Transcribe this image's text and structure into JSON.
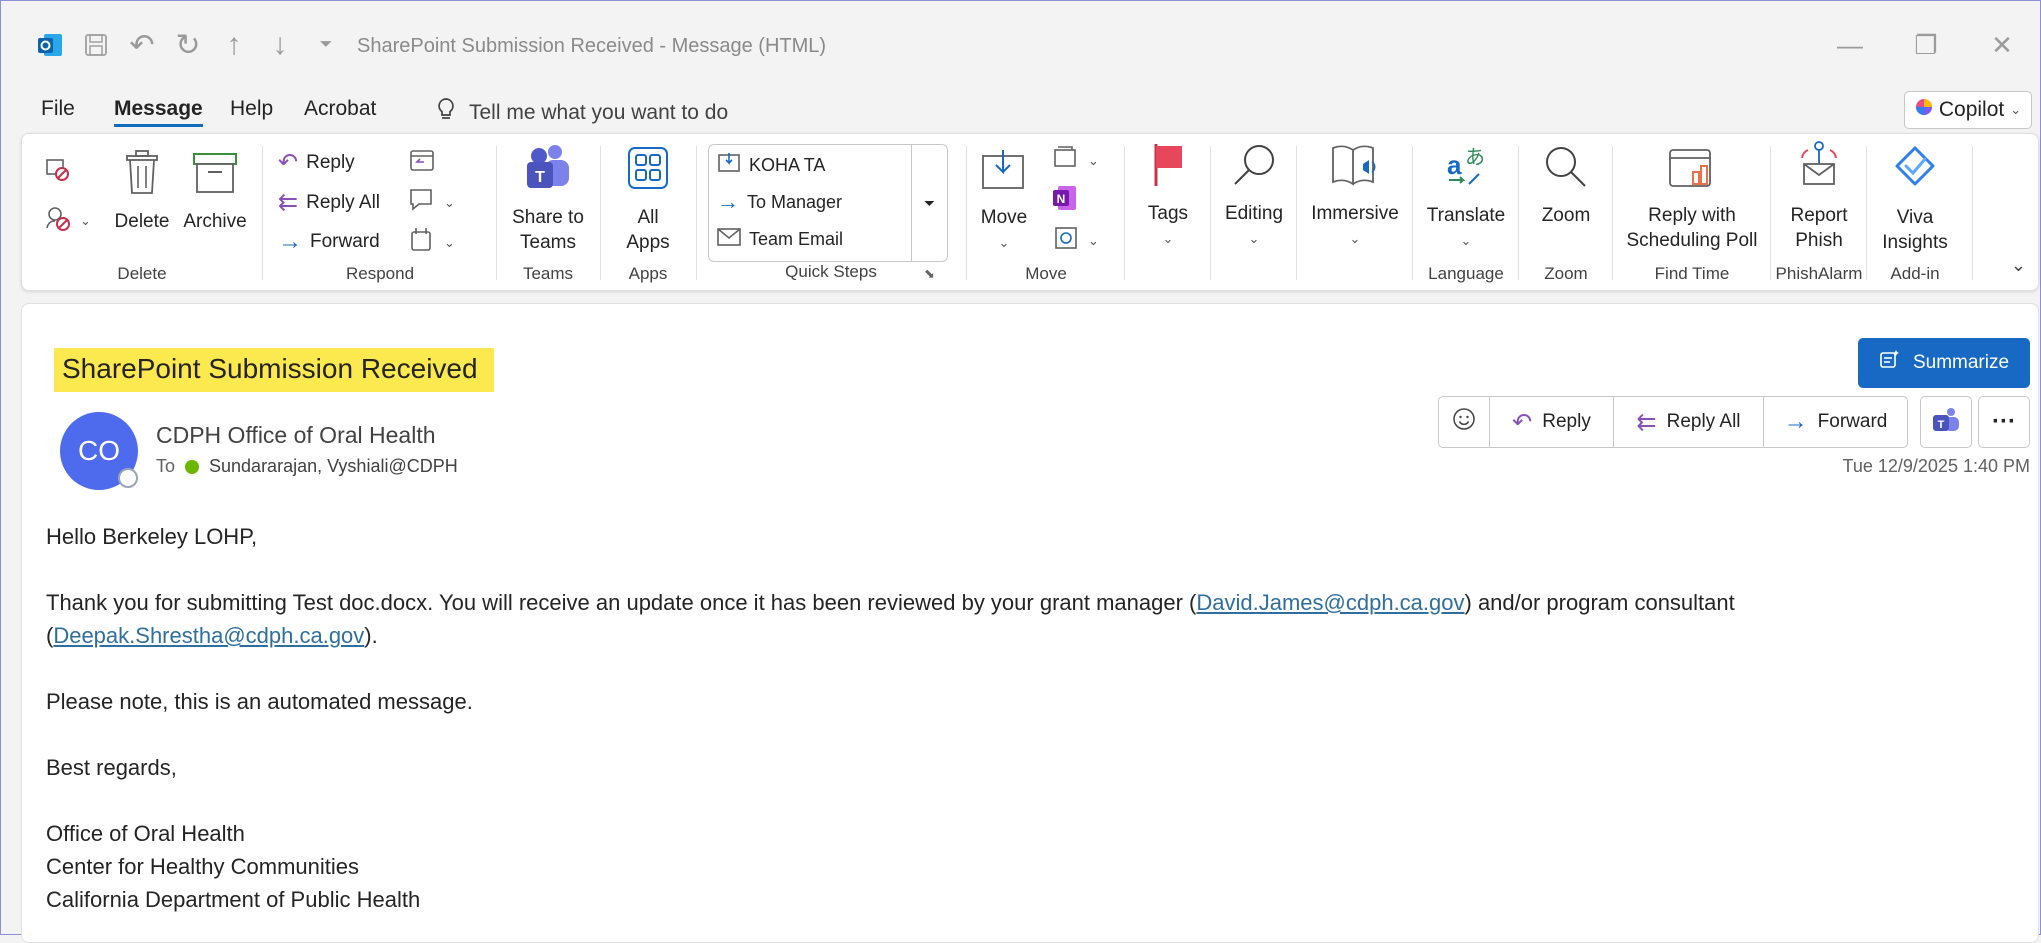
{
  "window": {
    "title": "SharePoint Submission Received  -  Message (HTML)"
  },
  "menu": {
    "file": "File",
    "message": "Message",
    "help": "Help",
    "acrobat": "Acrobat",
    "tellme": "Tell me what you want to do",
    "copilot": "Copilot"
  },
  "ribbon": {
    "delete_group": {
      "delete": "Delete",
      "archive": "Archive",
      "label": "Delete"
    },
    "respond_group": {
      "reply": "Reply",
      "reply_all": "Reply All",
      "forward": "Forward",
      "label": "Respond"
    },
    "teams_group": {
      "share": "Share to Teams",
      "label": "Teams"
    },
    "apps_group": {
      "all_apps": "All Apps",
      "label": "Apps"
    },
    "quick_steps": {
      "items": [
        "KOHA TA",
        "To Manager",
        "Team Email"
      ],
      "label": "Quick Steps"
    },
    "move_group": {
      "move": "Move",
      "label": "Move"
    },
    "tags": "Tags",
    "editing": "Editing",
    "immersive": "Immersive",
    "language_group": {
      "translate": "Translate",
      "label": "Language"
    },
    "zoom_group": {
      "zoom": "Zoom",
      "label": "Zoom"
    },
    "findtime_group": {
      "reply_poll": "Reply with Scheduling Poll",
      "label": "Find Time"
    },
    "phish_group": {
      "report": "Report Phish",
      "label": "PhishAlarm"
    },
    "addin_group": {
      "viva": "Viva Insights",
      "label": "Add-in"
    }
  },
  "message": {
    "subject": "SharePoint Submission Received",
    "summarize": "Summarize",
    "avatar_initials": "CO",
    "sender": "CDPH Office of Oral Health",
    "to_label": "To",
    "recipient": "Sundararajan, Vyshiali@CDPH",
    "actions": {
      "reply": "Reply",
      "reply_all": "Reply All",
      "forward": "Forward"
    },
    "timestamp": "Tue 12/9/2025 1:40 PM",
    "body": {
      "greeting": "Hello Berkeley LOHP,",
      "line1_a": "Thank you for submitting Test doc.docx. You will receive an update once it has been reviewed by your grant manager (",
      "link1": "David.James@cdph.ca.gov",
      "line1_b": ") and/or program consultant (",
      "link2": "Deepak.Shrestha@cdph.ca.gov",
      "line1_c": ").",
      "note": "Please note, this is an automated message.",
      "regards": "Best regards,",
      "sig1": "Office of Oral Health",
      "sig2": "Center for Healthy Communities",
      "sig3": "California Department of Public Health"
    }
  },
  "colors": {
    "accent": "#0f6cbd",
    "summarize_bg": "#1769c3",
    "avatar_bg": "#4f6bed",
    "subject_highlight": "#fce94f",
    "link": "#2f6f9f"
  }
}
